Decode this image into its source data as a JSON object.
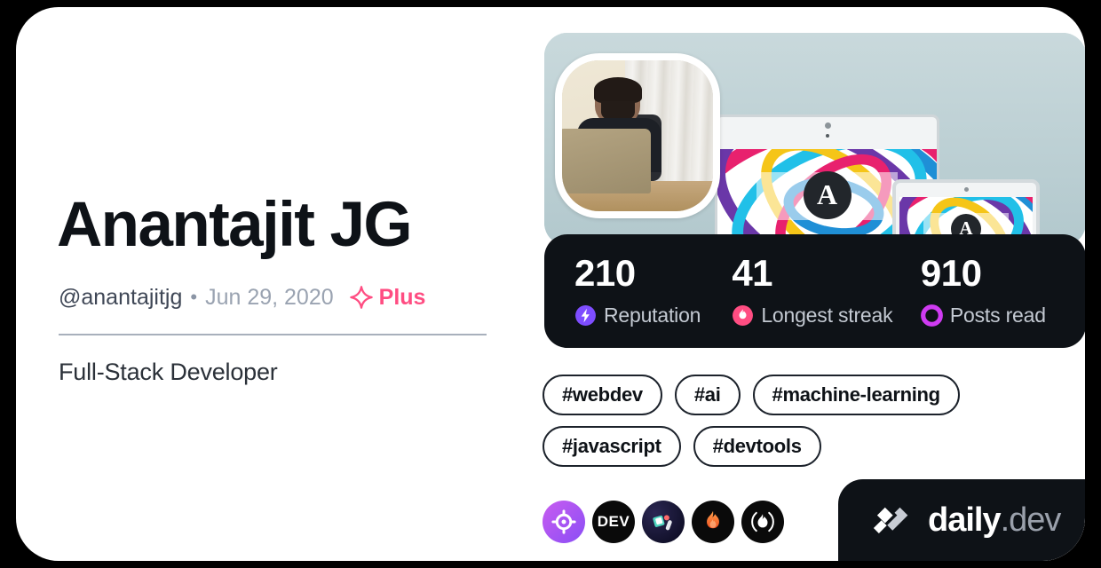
{
  "profile": {
    "name": "Anantajit JG",
    "handle": "@anantajitjg",
    "separator": "•",
    "join_date": "Jun 29, 2020",
    "plus_label": "Plus",
    "plus_color": "#ff4d82",
    "bio": "Full-Stack Developer",
    "avatar_alt": "profile-photo"
  },
  "stats": [
    {
      "id": "reputation",
      "value": "210",
      "label": "Reputation",
      "icon": "bolt-icon",
      "color": "#7e4dff"
    },
    {
      "id": "streak",
      "value": "41",
      "label": "Longest streak",
      "icon": "flame-icon",
      "color": "#ff4d82"
    },
    {
      "id": "posts",
      "value": "910",
      "label": "Posts read",
      "icon": "ring-icon",
      "color": "#cf3bf2"
    }
  ],
  "tags": [
    {
      "label": "#webdev"
    },
    {
      "label": "#ai"
    },
    {
      "label": "#machine-learning"
    },
    {
      "label": "#javascript"
    },
    {
      "label": "#devtools"
    }
  ],
  "badges": [
    {
      "id": "badge-0",
      "icon": "crosshair-target-icon",
      "color": "#a44ff2"
    },
    {
      "id": "badge-1",
      "icon": "dev-to-icon",
      "text": "DEV",
      "color": "#0a0a0a"
    },
    {
      "id": "badge-2",
      "icon": "hashnode-shapes-icon",
      "color": "#11102a"
    },
    {
      "id": "badge-3",
      "icon": "flame-icon",
      "color": "#ff6a33"
    },
    {
      "id": "badge-4",
      "icon": "flame-in-arcs-icon",
      "color": "#ffffff"
    }
  ],
  "watermark": {
    "logo_icon": "daily-dev-logo-icon",
    "name": "daily",
    "suffix": ".dev"
  },
  "theme": {
    "card_bg": "#ffffff",
    "page_bg": "#000000",
    "dark_panel": "#0e1217",
    "text_primary": "#0e1217",
    "text_muted": "#9aa3b1",
    "accent_pink": "#ff4d82"
  }
}
